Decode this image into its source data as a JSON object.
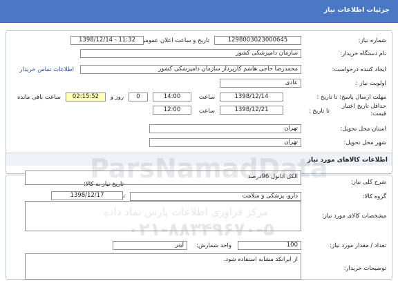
{
  "header": {
    "title": "جزئیات اطلاعات نیاز"
  },
  "need_info": {
    "need_number_label": "شماره نیاز:",
    "need_number": "1298003023000645",
    "announce_label": "تاریخ و ساعت اعلان عمومی:",
    "announce_value": "1398/12/14 - 11:32",
    "buyer_org_label": "نام دستگاه خریدار:",
    "buyer_org": "سازمان دامپزشکی کشور",
    "creator_label": "ایجاد کننده درخواست:",
    "creator": "محمدرضا حاجی هاشم کارپرداز سازمان دامپزشکی کشور",
    "contact_link": "اطلاعات تماس خریدار",
    "priority_label": "اولویت نیاز :",
    "priority": "عادی",
    "deadline_label": "مهلت ارسال پاسخ: تا تاریخ :",
    "deadline_date": "1398/12/14",
    "time_label": "ساعت",
    "deadline_time": "14:00",
    "remaining_days": "0",
    "days_and_label": "روز و",
    "remaining_time": "02:15:52",
    "remaining_label": "ساعت باقی مانده",
    "price_validity_label_1": "حداقل تاریخ اعتبار",
    "price_validity_label_2": "قیمت:",
    "until_date_label": "تا تاریخ :",
    "validity_date": "1398/12/21",
    "validity_time": "12:00",
    "delivery_province_label": "استان محل تحویل:",
    "delivery_province": "تهران",
    "delivery_city_label": "شهر محل تحویل:",
    "delivery_city": "تهران"
  },
  "goods": {
    "section_title": "اطلاعات کالاهای مورد نیاز",
    "summary_label": "شرح کلی نیاز:",
    "summary": "الکل اتانول 96درصد",
    "group_label": "گروه کالا:",
    "group": "دارو، پزشکی و سلامت",
    "need_date_label": "تاریخ نیاز به کالا:",
    "need_date": "1398/12/17",
    "specs_label": "مشخصات کالای مورد نیاز:",
    "specs": "",
    "quantity_label": "تعداد / مقدار مورد نیاز:",
    "quantity": "100",
    "unit_label": "واحد شمارش:",
    "unit": "لیتر",
    "buyer_notes_label": "توضیحات خریدار:",
    "buyer_notes": "از ایرانکد مشابه استفاده شود."
  },
  "watermark": {
    "brand": "ParsNamadData",
    "line1": "مرکز فراوری اطلاعات پارس نماد داده",
    "line2": "۰۲۱-۸۸۳۴۹۶۷۰-۵"
  }
}
